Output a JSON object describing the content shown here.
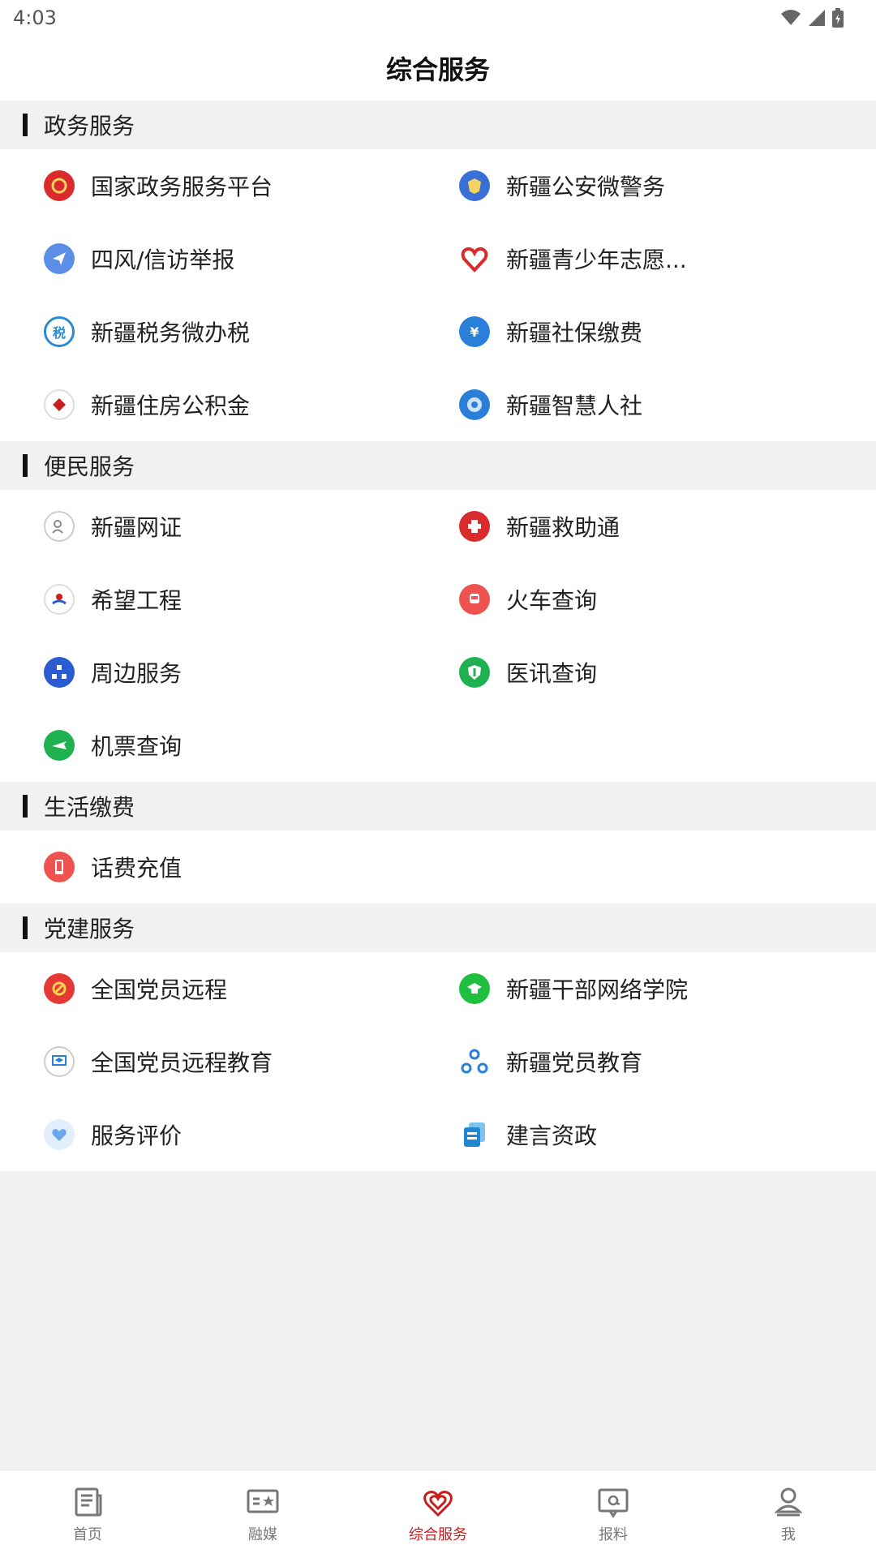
{
  "statusbar": {
    "time": "4:03"
  },
  "header": {
    "title": "综合服务"
  },
  "sections": [
    {
      "title": "政务服务",
      "items": [
        "国家政务服务平台",
        "新疆公安微警务",
        "四风/信访举报",
        "新疆青少年志愿...",
        "新疆税务微办税",
        "新疆社保缴费",
        "新疆住房公积金",
        "新疆智慧人社"
      ]
    },
    {
      "title": "便民服务",
      "items": [
        "新疆网证",
        "新疆救助通",
        "希望工程",
        "火车查询",
        "周边服务",
        "医讯查询",
        "机票查询"
      ]
    },
    {
      "title": "生活缴费",
      "items": [
        "话费充值"
      ]
    },
    {
      "title": "党建服务",
      "items": [
        "全国党员远程",
        "新疆干部网络学院",
        "全国党员远程教育",
        "新疆党员教育",
        "服务评价",
        "建言资政"
      ]
    }
  ],
  "icon_badges": {
    "tax": "税",
    "social": "¥"
  },
  "nav": [
    {
      "label": "首页"
    },
    {
      "label": "融媒"
    },
    {
      "label": "综合服务"
    },
    {
      "label": "报料"
    },
    {
      "label": "我"
    }
  ],
  "colors": {
    "accent": "#c81e1e",
    "section_bg": "#f1f1f1",
    "card_bg": "#ffffff"
  }
}
